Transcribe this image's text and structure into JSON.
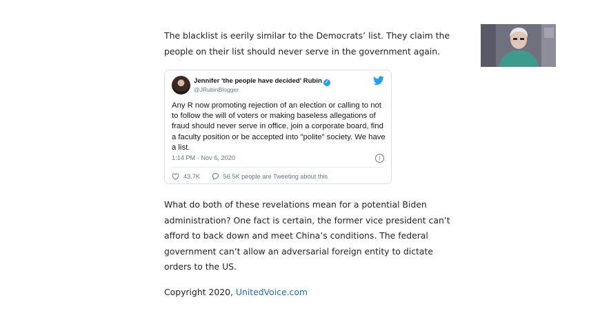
{
  "article": {
    "paragraph_1": "The blacklist is eerily similar to the Democrats’ list. They claim the people on their list should never serve in the government again.",
    "paragraph_2": "What do both of these revelations mean for a potential Biden administration? One fact is certain, the former vice president can’t afford to back down and meet China’s conditions. The federal government can’t allow an adversarial foreign entity to dictate orders to the US.",
    "copyright_prefix": "Copyright 2020, ",
    "copyright_link": "UnitedVoice.com"
  },
  "tweet": {
    "author_name": "Jennifer 'the people have decided' Rubin",
    "author_handle": "@JRubinBlogger",
    "text": "Any R now promoting rejection of an election or calling to not to follow the will of voters or making baseless allegations of fraud should never serve in office, join a corporate board, find a faculty position or be accepted into \"polite\" society. We have a list.",
    "timestamp": "1:14 PM · Nov 6, 2020",
    "likes": "43.7K",
    "tweeting_about": "56.5K people are Tweeting about this",
    "icons": {
      "brand": "twitter-bird-icon",
      "verified": "verified-badge-icon",
      "info": "info-icon",
      "like": "heart-icon",
      "reply": "speech-bubble-icon"
    },
    "colors": {
      "brand": "#1da1f2",
      "text": "#14171a",
      "muted": "#657786"
    }
  },
  "colors": {
    "link": "#1e6bb8",
    "body_text": "#222222"
  }
}
